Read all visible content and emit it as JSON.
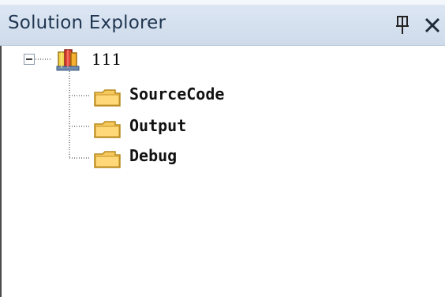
{
  "window": {
    "title": "Solution Explorer"
  },
  "tree": {
    "root": {
      "label": "111",
      "icon": "solution-icon",
      "expanded": true
    },
    "children": [
      {
        "label": "SourceCode",
        "icon": "folder-icon"
      },
      {
        "label": "Output",
        "icon": "folder-icon"
      },
      {
        "label": "Debug",
        "icon": "folder-icon"
      }
    ]
  },
  "colors": {
    "titlebar": "#d8e3f2",
    "title_text": "#1f3550",
    "folder": "#f6c95d",
    "background": "#ffffff"
  },
  "icons": {
    "pin": "pin-icon",
    "close": "close-icon",
    "expander": "minus-icon",
    "root": "solution-icon",
    "child": "folder-icon"
  }
}
